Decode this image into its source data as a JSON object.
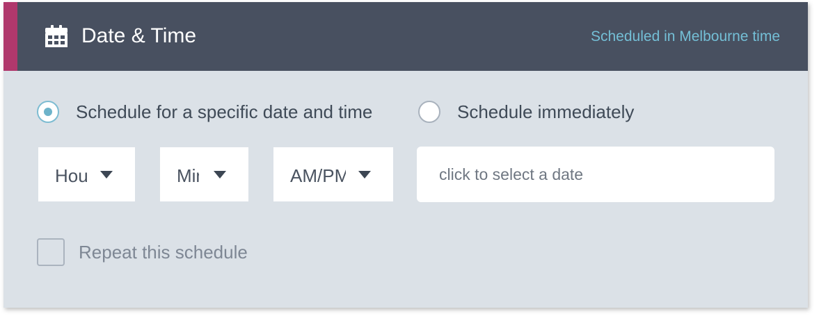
{
  "header": {
    "icon": "calendar-icon",
    "title": "Date & Time",
    "note": "Scheduled in Melbourne time",
    "colors": {
      "background": "#485060",
      "accent": "#b0386c",
      "note": "#74bfd6"
    }
  },
  "schedule_options": [
    {
      "label": "Schedule for a specific date and time",
      "selected": true
    },
    {
      "label": "Schedule immediately",
      "selected": false
    }
  ],
  "time_selects": {
    "hour": {
      "value": "Hour",
      "icon": "chevron-down-icon"
    },
    "minute": {
      "value": "Min",
      "icon": "chevron-down-icon"
    },
    "ampm": {
      "value": "AM/PM",
      "icon": "chevron-down-icon"
    }
  },
  "date_field": {
    "placeholder": "click to select a date",
    "value": ""
  },
  "repeat": {
    "label": "Repeat this schedule",
    "checked": false
  }
}
